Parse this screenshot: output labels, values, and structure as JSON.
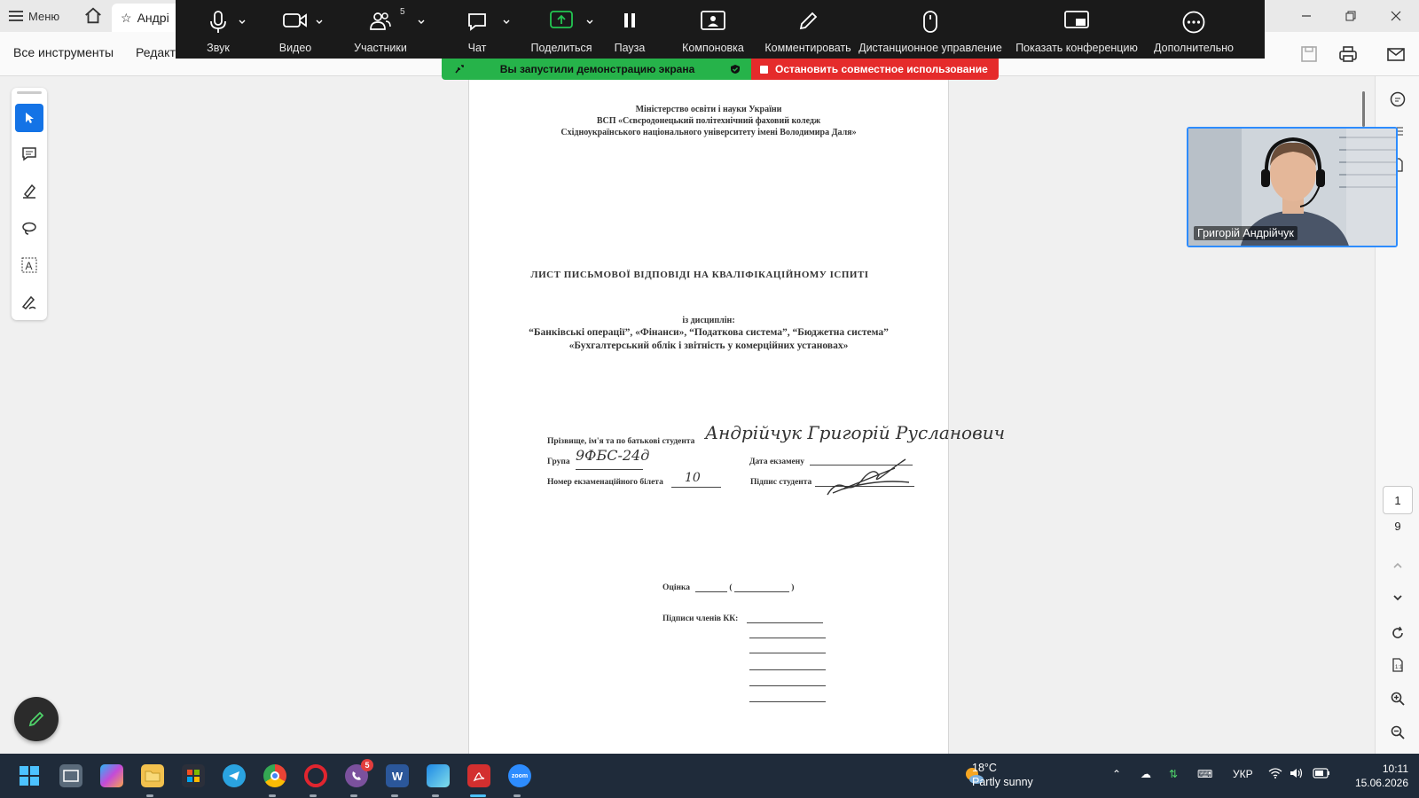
{
  "acrobat": {
    "menu_label": "Меню",
    "tab_title": "Андрі",
    "all_tools_label": "Все инструменты",
    "edit_label": "Редакт"
  },
  "zoom": {
    "buttons": [
      {
        "name": "audio",
        "label": "Звук"
      },
      {
        "name": "video",
        "label": "Видео"
      },
      {
        "name": "participants",
        "label": "Участники",
        "count": "5"
      },
      {
        "name": "chat",
        "label": "Чат"
      },
      {
        "name": "share",
        "label": "Поделиться"
      },
      {
        "name": "pause",
        "label": "Пауза"
      },
      {
        "name": "layout",
        "label": "Компоновка"
      },
      {
        "name": "annotate",
        "label": "Комментировать"
      },
      {
        "name": "remote-control",
        "label": "Дистанционное управление"
      },
      {
        "name": "show-conference",
        "label": "Показать конференцию"
      },
      {
        "name": "more",
        "label": "Дополнительно"
      }
    ],
    "share_status": "Вы запустили демонстрацию экрана",
    "stop_share": "Остановить совместное использование",
    "participant_name": "Григорій Андрійчук"
  },
  "document": {
    "header_lines": [
      "Міністерство освіти і науки України",
      "ВСП «Сєвєродонецький політехнічний фаховий коледж",
      "Східноукраїнського національного університету імені Володимира Даля»"
    ],
    "title": "ЛИСТ ПИСЬМОВОЇ ВІДПОВІДІ НА КВАЛІФІКАЦІЙНОМУ ІСПИТІ",
    "disciplines_intro": "із дисциплін:",
    "disciplines_line1": "“Банківські операції”, «Фінанси», “Податкова система”, “Бюджетна система”",
    "disciplines_line2": "«Бухгалтерський облік і звітність у комерційних установах»",
    "name_label": "Прізвище, ім'я та по батькові студента",
    "name_value": "Андрійчук Григорій Русланович",
    "group_label": "Група",
    "group_value": "9ФБС-24д",
    "exam_date_label": "Дата екзамену",
    "ticket_label": "Номер екзаменаційного білета",
    "ticket_value": "10",
    "student_signature_label": "Підпис студента",
    "grade_label": "Оцінка",
    "commission_label": "Підписи членів КК:"
  },
  "navigation": {
    "current_page": "1",
    "total_pages": "9"
  },
  "taskbar": {
    "temperature": "18°C",
    "weather": "Partly sunny",
    "language": "УКР",
    "time": "10:11",
    "date": "15.06.2026",
    "viber_badge": "5"
  }
}
